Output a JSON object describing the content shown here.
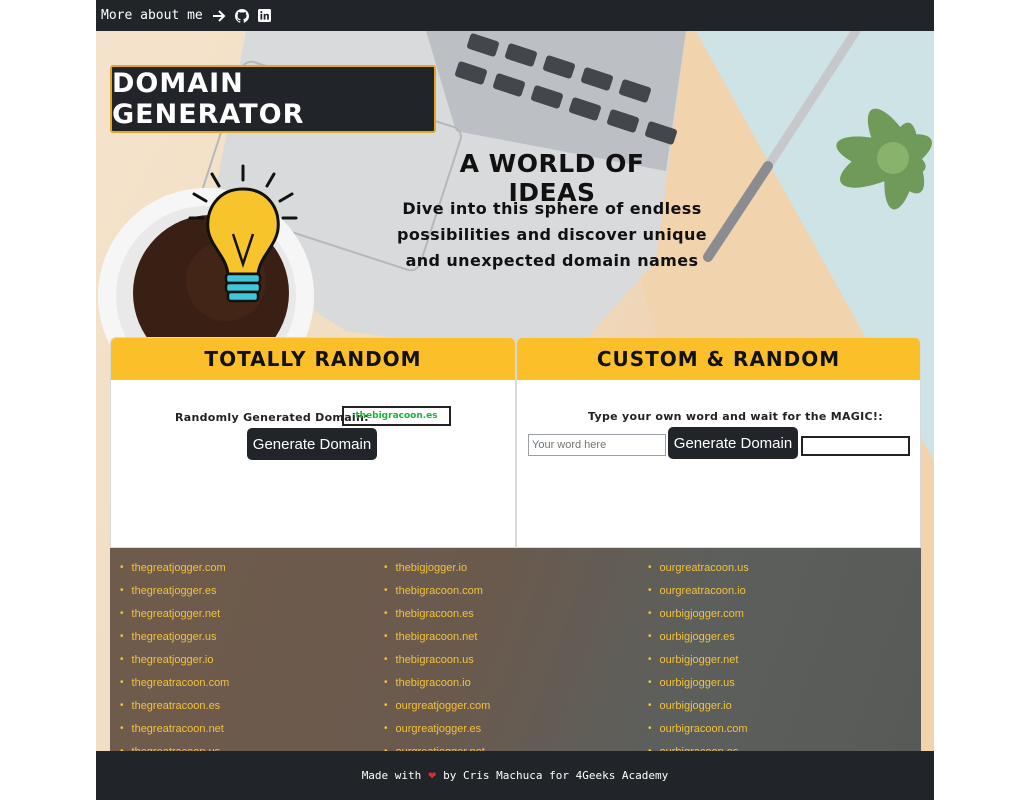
{
  "nav": {
    "text": "More about me",
    "arrow_icon": "arrow-right-icon",
    "github_icon": "github-icon",
    "linkedin_icon": "linkedin-icon"
  },
  "brand": {
    "title": "DOMAIN GENERATOR"
  },
  "hero": {
    "tagline": "A WORLD OF IDEAS",
    "intro": "Dive into this sphere of endless possibilities and discover unique and unexpected domain names"
  },
  "random_card": {
    "title": "TOTALLY RANDOM",
    "label": "Randomly Generated Domain:",
    "output": "thebigracoon.es",
    "button": "Generate Domain"
  },
  "custom_card": {
    "title": "CUSTOM & RANDOM",
    "label": "Type your own word and wait for the MAGIC!:",
    "input_placeholder": "Your word here",
    "button": "Generate Domain",
    "output": ""
  },
  "domain_columns": [
    [
      "thegreatjogger.com",
      "thegreatjogger.es",
      "thegreatjogger.net",
      "thegreatjogger.us",
      "thegreatjogger.io",
      "thegreatracoon.com",
      "thegreatracoon.es",
      "thegreatracoon.net",
      "thegreatracoon.us"
    ],
    [
      "thebigjogger.io",
      "thebigracoon.com",
      "thebigracoon.es",
      "thebigracoon.net",
      "thebigracoon.us",
      "thebigracoon.io",
      "ourgreatjogger.com",
      "ourgreatjogger.es",
      "ourgreatjogger.net"
    ],
    [
      "ourgreatracoon.us",
      "ourgreatracoon.io",
      "ourbigjogger.com",
      "ourbigjogger.es",
      "ourbigjogger.net",
      "ourbigjogger.us",
      "ourbigjogger.io",
      "ourbigracoon.com",
      "ourbigracoon.es"
    ]
  ],
  "footer": {
    "made_with": "Made with",
    "heart_icon": "heart-icon",
    "by": "by Cris Machuca for 4Geeks Academy"
  },
  "colors": {
    "accent": "#fbbf2a",
    "dark": "#212529",
    "link": "#f4c23b",
    "output_text": "#19b33c",
    "heart": "#e0292b"
  }
}
